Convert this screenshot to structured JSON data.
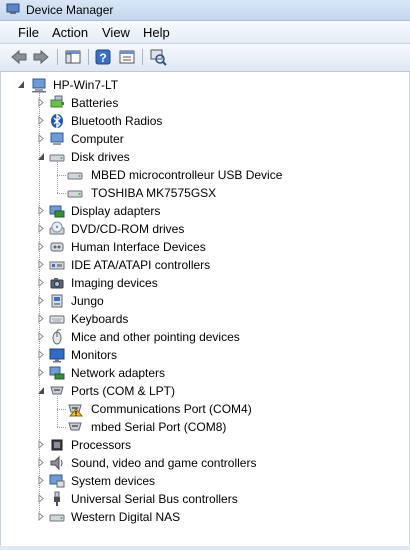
{
  "window": {
    "title": "Device Manager"
  },
  "menu": [
    "File",
    "Action",
    "View",
    "Help"
  ],
  "toolbar": [
    "back",
    "forward",
    "show-hide-console-tree",
    "help",
    "properties",
    "scan-for-hardware-changes"
  ],
  "tree": {
    "root": "HP-Win7-LT",
    "categories": [
      {
        "label": "Batteries",
        "icon": "battery-icon",
        "expanded": false
      },
      {
        "label": "Bluetooth Radios",
        "icon": "bluetooth-icon",
        "expanded": false
      },
      {
        "label": "Computer",
        "icon": "computer-icon",
        "expanded": false
      },
      {
        "label": "Disk drives",
        "icon": "disk-drive-icon",
        "expanded": true,
        "children": [
          "MBED microcontrolleur USB Device",
          "TOSHIBA MK7575GSX"
        ]
      },
      {
        "label": "Display adapters",
        "icon": "display-adapter-icon",
        "expanded": false
      },
      {
        "label": "DVD/CD-ROM drives",
        "icon": "dvd-drive-icon",
        "expanded": false
      },
      {
        "label": "Human Interface Devices",
        "icon": "hid-icon",
        "expanded": false
      },
      {
        "label": "IDE ATA/ATAPI controllers",
        "icon": "ide-controller-icon",
        "expanded": false
      },
      {
        "label": "Imaging devices",
        "icon": "camera-icon",
        "expanded": false
      },
      {
        "label": "Jungo",
        "icon": "usb-device-icon",
        "expanded": false
      },
      {
        "label": "Keyboards",
        "icon": "keyboard-icon",
        "expanded": false
      },
      {
        "label": "Mice and other pointing devices",
        "icon": "mouse-icon",
        "expanded": false
      },
      {
        "label": "Monitors",
        "icon": "monitor-icon",
        "expanded": false
      },
      {
        "label": "Network adapters",
        "icon": "network-adapter-icon",
        "expanded": false
      },
      {
        "label": "Ports (COM & LPT)",
        "icon": "port-icon",
        "expanded": true,
        "children": [
          "Communications Port (COM4)",
          "mbed Serial Port (COM8)"
        ]
      },
      {
        "label": "Processors",
        "icon": "processor-icon",
        "expanded": false
      },
      {
        "label": "Sound, video and game controllers",
        "icon": "speaker-icon",
        "expanded": false
      },
      {
        "label": "System devices",
        "icon": "system-device-icon",
        "expanded": false
      },
      {
        "label": "Universal Serial Bus controllers",
        "icon": "usb-plug-icon",
        "expanded": false
      },
      {
        "label": "Western Digital NAS",
        "icon": "nas-drive-icon",
        "expanded": false
      }
    ],
    "warning_devices": [
      "Communications Port (COM4)"
    ]
  }
}
